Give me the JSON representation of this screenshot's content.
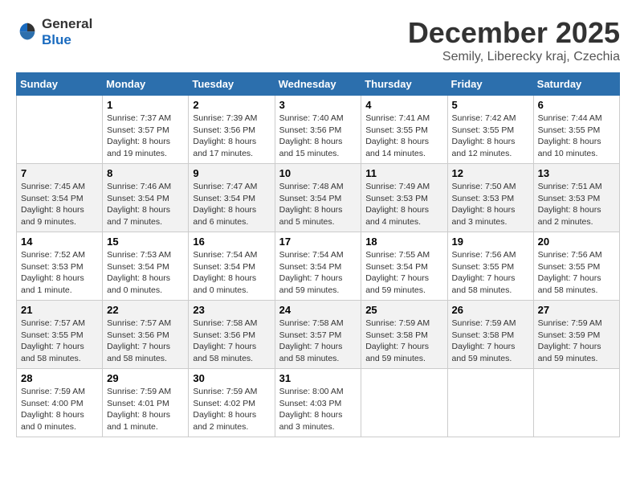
{
  "logo": {
    "general": "General",
    "blue": "Blue"
  },
  "header": {
    "month": "December 2025",
    "location": "Semily, Liberecky kraj, Czechia"
  },
  "days_of_week": [
    "Sunday",
    "Monday",
    "Tuesday",
    "Wednesday",
    "Thursday",
    "Friday",
    "Saturday"
  ],
  "weeks": [
    [
      {
        "day": "",
        "info": ""
      },
      {
        "day": "1",
        "info": "Sunrise: 7:37 AM\nSunset: 3:57 PM\nDaylight: 8 hours\nand 19 minutes."
      },
      {
        "day": "2",
        "info": "Sunrise: 7:39 AM\nSunset: 3:56 PM\nDaylight: 8 hours\nand 17 minutes."
      },
      {
        "day": "3",
        "info": "Sunrise: 7:40 AM\nSunset: 3:56 PM\nDaylight: 8 hours\nand 15 minutes."
      },
      {
        "day": "4",
        "info": "Sunrise: 7:41 AM\nSunset: 3:55 PM\nDaylight: 8 hours\nand 14 minutes."
      },
      {
        "day": "5",
        "info": "Sunrise: 7:42 AM\nSunset: 3:55 PM\nDaylight: 8 hours\nand 12 minutes."
      },
      {
        "day": "6",
        "info": "Sunrise: 7:44 AM\nSunset: 3:55 PM\nDaylight: 8 hours\nand 10 minutes."
      }
    ],
    [
      {
        "day": "7",
        "info": "Sunrise: 7:45 AM\nSunset: 3:54 PM\nDaylight: 8 hours\nand 9 minutes."
      },
      {
        "day": "8",
        "info": "Sunrise: 7:46 AM\nSunset: 3:54 PM\nDaylight: 8 hours\nand 7 minutes."
      },
      {
        "day": "9",
        "info": "Sunrise: 7:47 AM\nSunset: 3:54 PM\nDaylight: 8 hours\nand 6 minutes."
      },
      {
        "day": "10",
        "info": "Sunrise: 7:48 AM\nSunset: 3:54 PM\nDaylight: 8 hours\nand 5 minutes."
      },
      {
        "day": "11",
        "info": "Sunrise: 7:49 AM\nSunset: 3:53 PM\nDaylight: 8 hours\nand 4 minutes."
      },
      {
        "day": "12",
        "info": "Sunrise: 7:50 AM\nSunset: 3:53 PM\nDaylight: 8 hours\nand 3 minutes."
      },
      {
        "day": "13",
        "info": "Sunrise: 7:51 AM\nSunset: 3:53 PM\nDaylight: 8 hours\nand 2 minutes."
      }
    ],
    [
      {
        "day": "14",
        "info": "Sunrise: 7:52 AM\nSunset: 3:53 PM\nDaylight: 8 hours\nand 1 minute."
      },
      {
        "day": "15",
        "info": "Sunrise: 7:53 AM\nSunset: 3:54 PM\nDaylight: 8 hours\nand 0 minutes."
      },
      {
        "day": "16",
        "info": "Sunrise: 7:54 AM\nSunset: 3:54 PM\nDaylight: 8 hours\nand 0 minutes."
      },
      {
        "day": "17",
        "info": "Sunrise: 7:54 AM\nSunset: 3:54 PM\nDaylight: 7 hours\nand 59 minutes."
      },
      {
        "day": "18",
        "info": "Sunrise: 7:55 AM\nSunset: 3:54 PM\nDaylight: 7 hours\nand 59 minutes."
      },
      {
        "day": "19",
        "info": "Sunrise: 7:56 AM\nSunset: 3:55 PM\nDaylight: 7 hours\nand 58 minutes."
      },
      {
        "day": "20",
        "info": "Sunrise: 7:56 AM\nSunset: 3:55 PM\nDaylight: 7 hours\nand 58 minutes."
      }
    ],
    [
      {
        "day": "21",
        "info": "Sunrise: 7:57 AM\nSunset: 3:55 PM\nDaylight: 7 hours\nand 58 minutes."
      },
      {
        "day": "22",
        "info": "Sunrise: 7:57 AM\nSunset: 3:56 PM\nDaylight: 7 hours\nand 58 minutes."
      },
      {
        "day": "23",
        "info": "Sunrise: 7:58 AM\nSunset: 3:56 PM\nDaylight: 7 hours\nand 58 minutes."
      },
      {
        "day": "24",
        "info": "Sunrise: 7:58 AM\nSunset: 3:57 PM\nDaylight: 7 hours\nand 58 minutes."
      },
      {
        "day": "25",
        "info": "Sunrise: 7:59 AM\nSunset: 3:58 PM\nDaylight: 7 hours\nand 59 minutes."
      },
      {
        "day": "26",
        "info": "Sunrise: 7:59 AM\nSunset: 3:58 PM\nDaylight: 7 hours\nand 59 minutes."
      },
      {
        "day": "27",
        "info": "Sunrise: 7:59 AM\nSunset: 3:59 PM\nDaylight: 7 hours\nand 59 minutes."
      }
    ],
    [
      {
        "day": "28",
        "info": "Sunrise: 7:59 AM\nSunset: 4:00 PM\nDaylight: 8 hours\nand 0 minutes."
      },
      {
        "day": "29",
        "info": "Sunrise: 7:59 AM\nSunset: 4:01 PM\nDaylight: 8 hours\nand 1 minute."
      },
      {
        "day": "30",
        "info": "Sunrise: 7:59 AM\nSunset: 4:02 PM\nDaylight: 8 hours\nand 2 minutes."
      },
      {
        "day": "31",
        "info": "Sunrise: 8:00 AM\nSunset: 4:03 PM\nDaylight: 8 hours\nand 3 minutes."
      },
      {
        "day": "",
        "info": ""
      },
      {
        "day": "",
        "info": ""
      },
      {
        "day": "",
        "info": ""
      }
    ]
  ]
}
